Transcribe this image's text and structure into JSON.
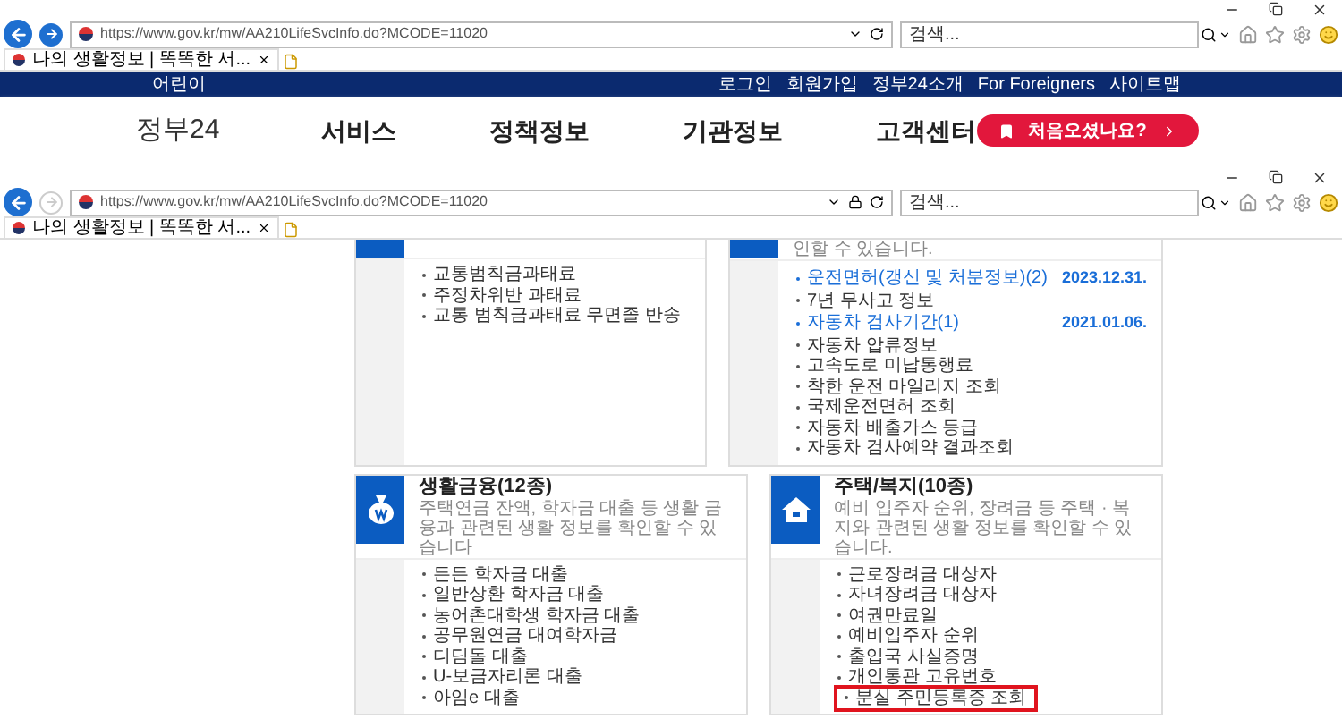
{
  "windows": [
    {
      "address_bar": {
        "url": "https://www.gov.kr/mw/AA210LifeSvcInfo.do?MCODE=11020",
        "secure": false
      },
      "search": {
        "placeholder": "검색..."
      },
      "tab": {
        "title": "나의 생활정보 | 똑똑한 서..."
      },
      "site_header": {
        "utility_left": "어린이",
        "utility_links": [
          "로그인",
          "회원가입",
          "정부24소개",
          "For Foreigners",
          "사이트맵"
        ],
        "logo": "정부24",
        "nav": [
          "서비스",
          "정책정보",
          "기관정보",
          "고객센터"
        ],
        "cta": "처음오셨나요?"
      }
    },
    {
      "address_bar": {
        "url": "https://www.gov.kr/mw/AA210LifeSvcInfo.do?MCODE=11020",
        "secure": true
      },
      "search": {
        "placeholder": "검색..."
      },
      "tab": {
        "title": "나의 생활정보 | 똑똑한 서..."
      }
    }
  ],
  "card_rows": [
    [
      {
        "kind": "plain",
        "items": [
          {
            "kind": "plain",
            "label": "교통범칙금과태료",
            "highlighted": false
          },
          {
            "kind": "plain",
            "label": "주정차위반 과태료",
            "highlighted": false
          },
          {
            "kind": "plain",
            "label": "교통 범칙금과태료 무면졸 반송",
            "highlighted": false
          }
        ]
      },
      {
        "kind": "plain",
        "description": "인할 수 있습니다.",
        "items": [
          {
            "kind": "link",
            "label": "운전면허(갱신 및 처분정보)(2)",
            "date": "2023.12.31.",
            "highlighted": false
          },
          {
            "kind": "plain",
            "label": "7년 무사고 정보",
            "highlighted": false
          },
          {
            "kind": "link",
            "label": "자동차 검사기간(1)",
            "date": "2021.01.06.",
            "highlighted": false
          },
          {
            "kind": "plain",
            "label": "자동차 압류정보",
            "highlighted": false
          },
          {
            "kind": "plain",
            "label": "고속도로 미납통행료",
            "highlighted": false
          },
          {
            "kind": "plain",
            "label": "착한 운전 마일리지 조회",
            "highlighted": false
          },
          {
            "kind": "plain",
            "label": "국제운전면허 조회",
            "highlighted": false
          },
          {
            "kind": "plain",
            "label": "자동차 배출가스 등급",
            "highlighted": false
          },
          {
            "kind": "plain",
            "label": "자동차 검사예약 결과조회",
            "highlighted": false
          }
        ]
      }
    ],
    [
      {
        "kind": "finance",
        "title": "생활금융(12종)",
        "description": "주택연금 잔액, 학자금 대출 등 생활 금융과 관련된 생활 정보를 확인할 수 있습니다",
        "items": [
          {
            "kind": "plain",
            "label": "든든 학자금 대출",
            "highlighted": false
          },
          {
            "kind": "plain",
            "label": "일반상환 학자금 대출",
            "highlighted": false
          },
          {
            "kind": "plain",
            "label": "농어촌대학생 학자금 대출",
            "highlighted": false
          },
          {
            "kind": "plain",
            "label": "공무원연금 대여학자금",
            "highlighted": false
          },
          {
            "kind": "plain",
            "label": "디딤돌 대출",
            "highlighted": false
          },
          {
            "kind": "plain",
            "label": "U-보금자리론 대출",
            "highlighted": false
          },
          {
            "kind": "plain",
            "label": "아임e 대출",
            "highlighted": false
          }
        ]
      },
      {
        "kind": "housing",
        "title": "주택/복지(10종)",
        "description": "예비 입주자 순위, 장려금 등 주택 · 복지와 관련된 생활 정보를 확인할 수 있습니다.",
        "items": [
          {
            "kind": "plain",
            "label": "근로장려금 대상자",
            "highlighted": false
          },
          {
            "kind": "plain",
            "label": "자녀장려금 대상자",
            "highlighted": false
          },
          {
            "kind": "plain",
            "label": "여권만료일",
            "highlighted": false
          },
          {
            "kind": "plain",
            "label": "예비입주자 순위",
            "highlighted": false
          },
          {
            "kind": "plain",
            "label": "출입국 사실증명",
            "highlighted": false
          },
          {
            "kind": "plain",
            "label": "개인통관 고유번호",
            "highlighted": false
          },
          {
            "kind": "plain",
            "label": "분실 주민등록증 조회",
            "highlighted": true
          }
        ]
      }
    ]
  ]
}
